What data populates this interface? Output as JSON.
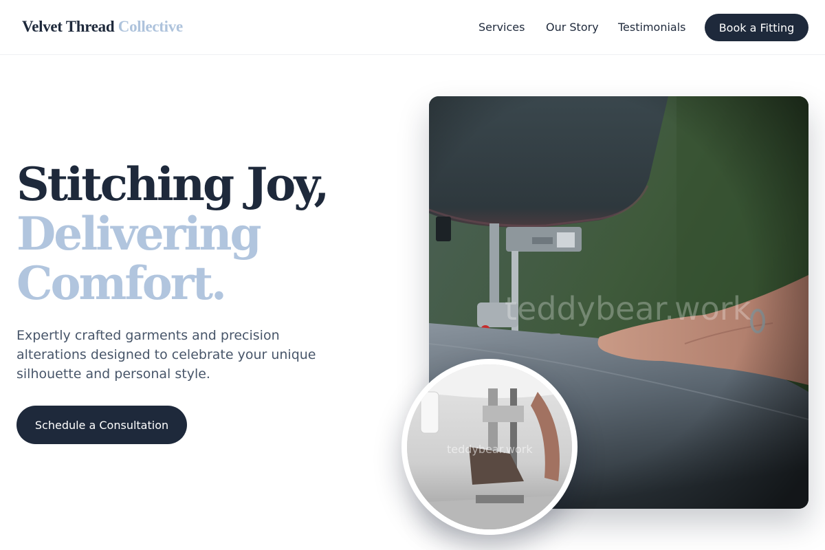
{
  "brand": {
    "name_primary": "Velvet Thread",
    "name_accent": "Collective"
  },
  "nav": {
    "links": [
      "Services",
      "Our Story",
      "Testimonials"
    ],
    "cta_label": "Book a Fitting"
  },
  "hero": {
    "headline_line1": "Stitching Joy,",
    "headline_line2": "Delivering",
    "headline_line3": "Comfort.",
    "subtext": "Expertly crafted garments and precision alterations designed to celebrate your unique silhouette and personal style.",
    "cta_label": "Schedule a Consultation"
  },
  "images": {
    "main_watermark": "teddybear.work",
    "inset_watermark": "teddybear.work"
  },
  "colors": {
    "navy": "#1e293b",
    "accent_light_blue": "#b1c5de",
    "body_text": "#475569"
  }
}
